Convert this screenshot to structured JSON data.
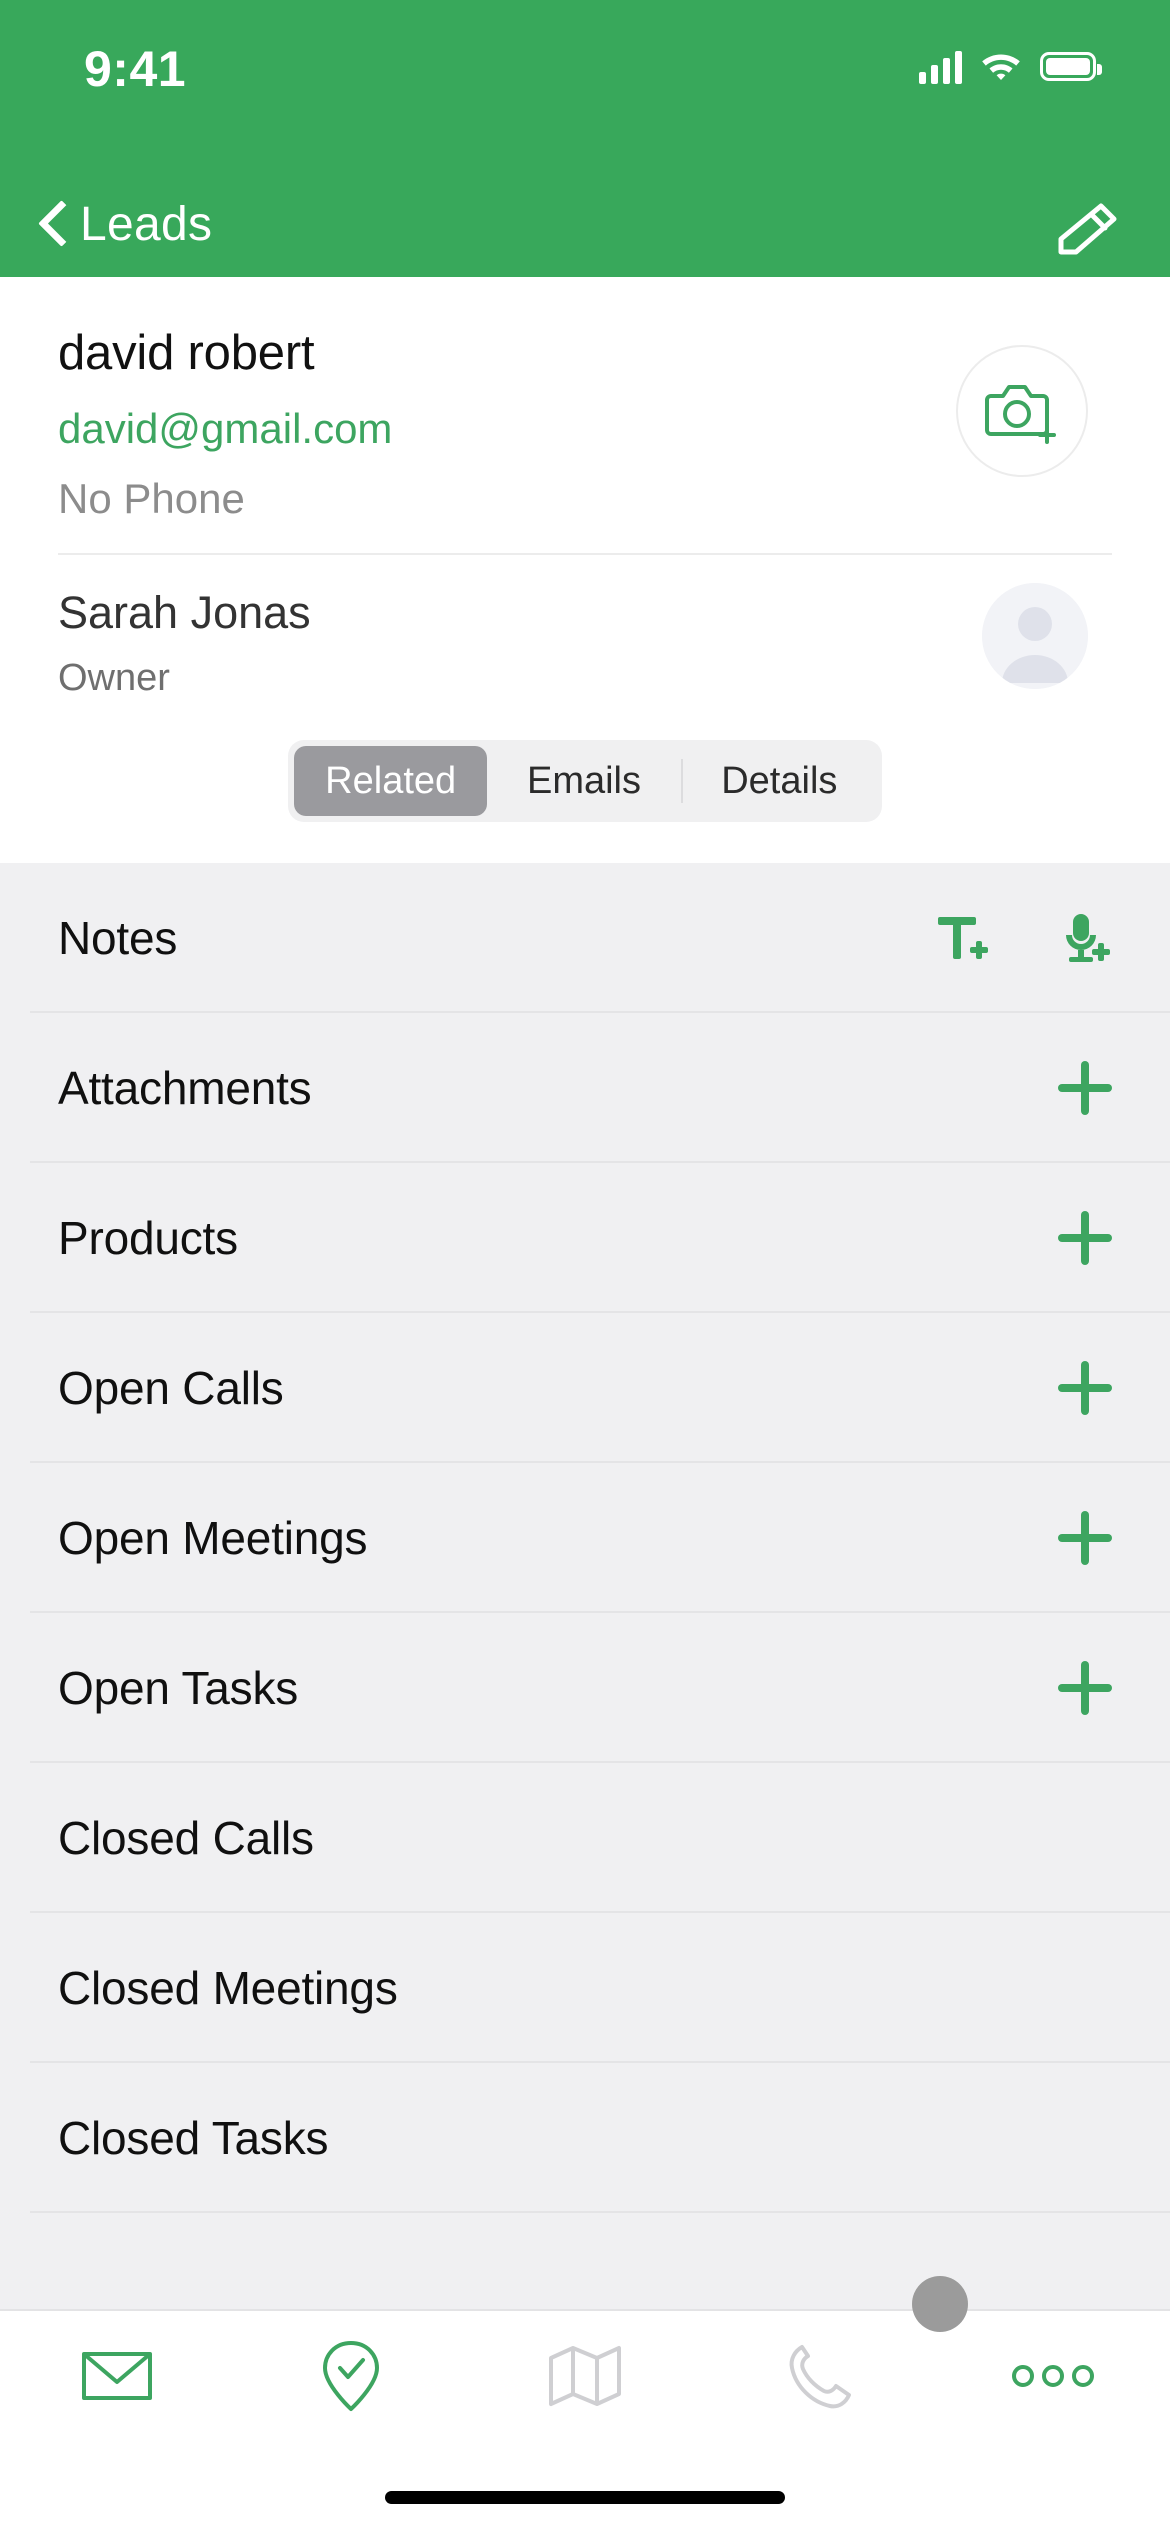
{
  "status_bar": {
    "time": "9:41",
    "signal_icon": "signal-bars-icon",
    "wifi_icon": "wifi-icon",
    "battery_icon": "battery-icon"
  },
  "nav_bar": {
    "back_label": "Leads",
    "back_icon": "chevron-left-icon",
    "edit_icon": "pencil-edit-icon",
    "background_color": "#38a85b"
  },
  "contact": {
    "name": "david robert",
    "email": "david@gmail.com",
    "phone": "No Phone",
    "email_color": "#3da560",
    "camera_icon": "camera-add-icon"
  },
  "owner": {
    "name": "Sarah Jonas",
    "role": "Owner",
    "avatar_icon": "person-avatar-icon"
  },
  "tabs": {
    "items": [
      {
        "label": "Related",
        "active": true
      },
      {
        "label": "Emails",
        "active": false
      },
      {
        "label": "Details",
        "active": false
      }
    ],
    "active_background": "#9a9a9e"
  },
  "related_list": [
    {
      "label": "Notes",
      "action": "notes-icons"
    },
    {
      "label": "Attachments",
      "action": "plus"
    },
    {
      "label": "Products",
      "action": "plus"
    },
    {
      "label": "Open Calls",
      "action": "plus"
    },
    {
      "label": "Open Meetings",
      "action": "plus"
    },
    {
      "label": "Open Tasks",
      "action": "plus"
    },
    {
      "label": "Closed Calls",
      "action": "none"
    },
    {
      "label": "Closed Meetings",
      "action": "none"
    },
    {
      "label": "Closed Tasks",
      "action": "none"
    }
  ],
  "notes_actions": {
    "add_text_note_icon": "text-add-icon",
    "add_voice_note_icon": "microphone-add-icon"
  },
  "bottom_tab_bar": {
    "items": [
      {
        "icon": "email-envelope-icon",
        "color": "#3da560"
      },
      {
        "icon": "check-in-pin-icon",
        "color": "#3da560"
      },
      {
        "icon": "map-icon",
        "color": "#cfcfd2"
      },
      {
        "icon": "phone-call-icon",
        "color": "#cfcfd2"
      },
      {
        "icon": "more-dots-icon",
        "color": "#3da560"
      }
    ]
  },
  "accent_color": "#3da560",
  "list_background": "#f0f0f2"
}
